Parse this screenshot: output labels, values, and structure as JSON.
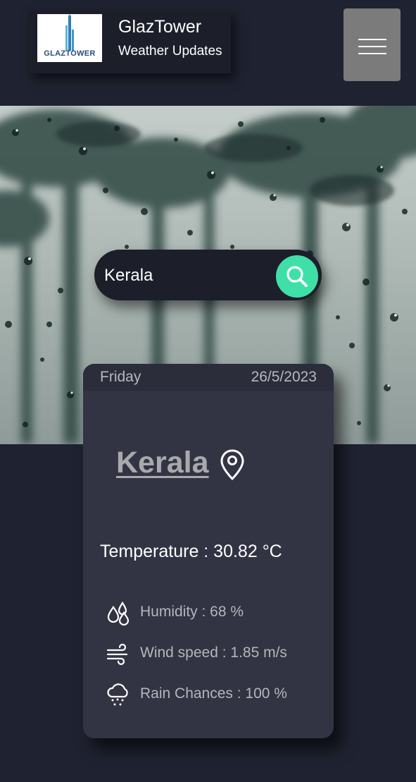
{
  "header": {
    "logo_text": "GLAZTOWER",
    "title": "GlazTower",
    "subtitle": "Weather Updates"
  },
  "menu": {
    "icon": "hamburger-menu-icon"
  },
  "search": {
    "value": "Kerala",
    "icon": "search-icon"
  },
  "card": {
    "day": "Friday",
    "date": "26/5/2023",
    "city": "Kerala",
    "city_icon": "location-pin-icon",
    "temperature": "Temperature : 30.82 °C",
    "stats": [
      {
        "icon": "humidity-drops-icon",
        "label": "Humidity : 68 %"
      },
      {
        "icon": "wind-icon",
        "label": "Wind speed : 1.85 m/s"
      },
      {
        "icon": "rain-cloud-icon",
        "label": "Rain Chances : 100 %"
      }
    ]
  },
  "colors": {
    "background": "#1f2230",
    "card": "#323444",
    "accent": "#3fe0a8",
    "menu_button": "#7b7b7b"
  }
}
